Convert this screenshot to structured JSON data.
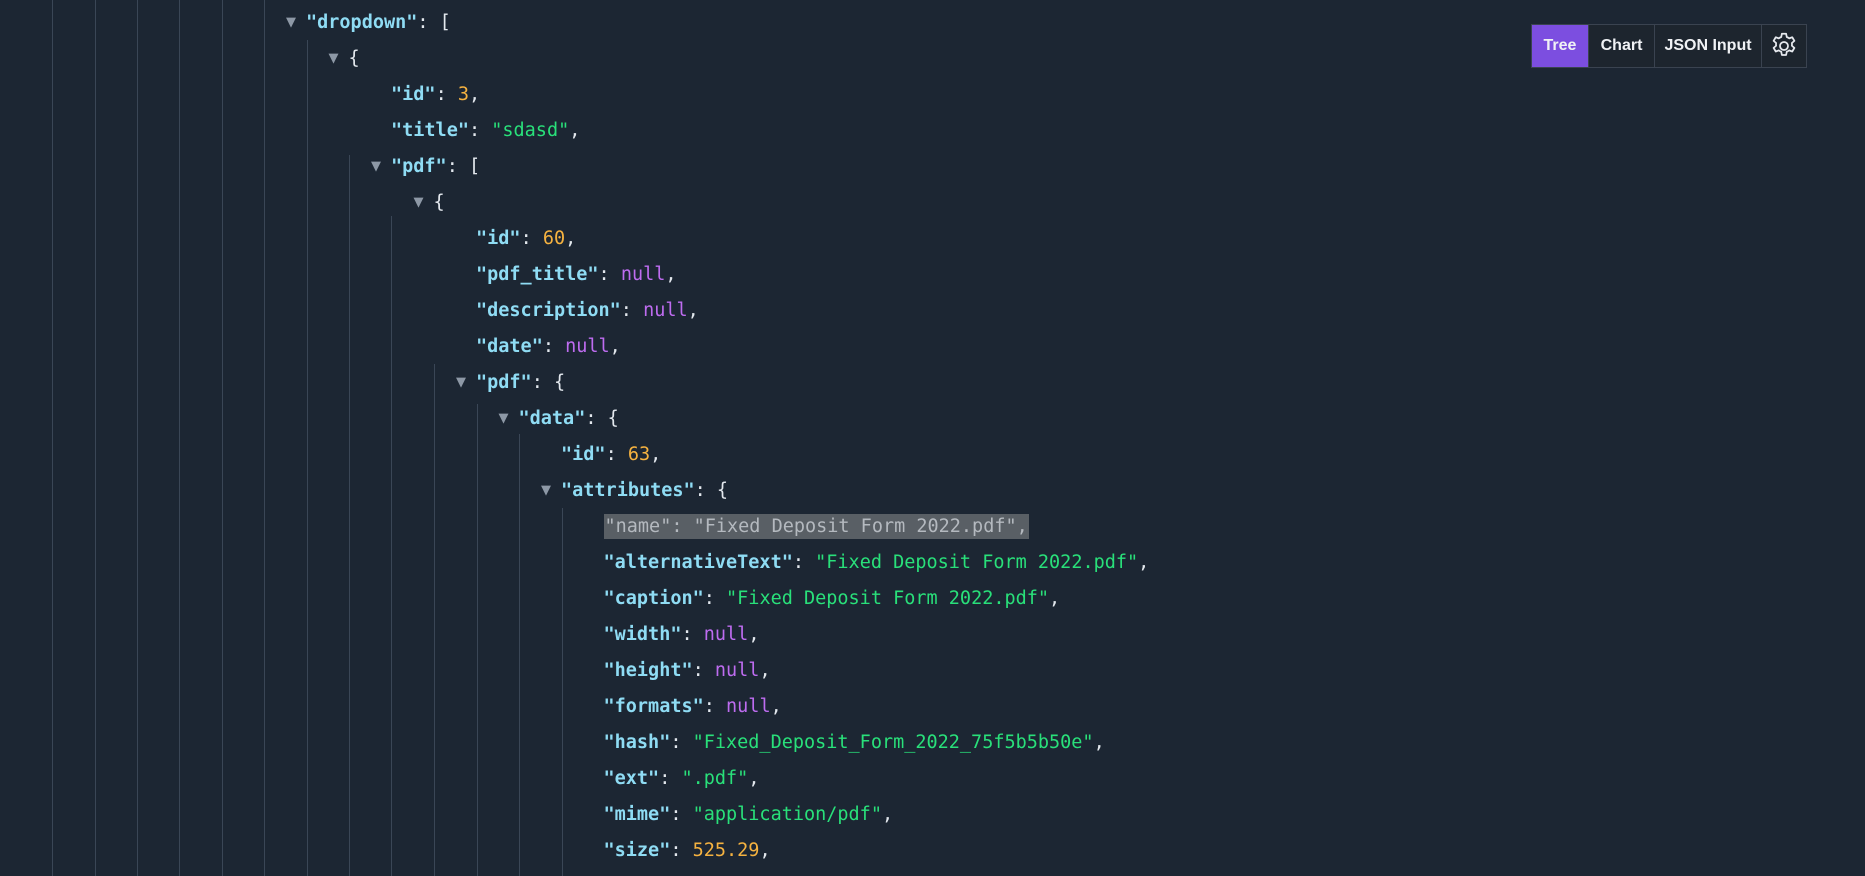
{
  "toolbar": {
    "tabs": [
      "Tree",
      "Chart",
      "JSON Input"
    ],
    "active_tab": "Tree",
    "active_color": "#7c4ee0",
    "settings_icon": "gear-icon"
  },
  "colors": {
    "background": "#1c2633",
    "key": "#8fdcf4",
    "string": "#29e07a",
    "number": "#f5b240",
    "null": "#be6cf0",
    "highlight": "#595f65"
  },
  "tree": [
    {
      "toggle": true,
      "tokens": [
        {
          "t": "key",
          "v": "\"dropdown\""
        },
        {
          "t": "pun",
          "v": ": ["
        }
      ]
    },
    {
      "toggle": true,
      "tokens": [
        {
          "t": "pun",
          "v": "{"
        }
      ]
    },
    {
      "toggle": false,
      "tokens": [
        {
          "t": "key",
          "v": "\"id\""
        },
        {
          "t": "pun",
          "v": ": "
        },
        {
          "t": "num",
          "v": "3"
        },
        {
          "t": "pun",
          "v": ","
        }
      ]
    },
    {
      "toggle": false,
      "tokens": [
        {
          "t": "key",
          "v": "\"title\""
        },
        {
          "t": "pun",
          "v": ": "
        },
        {
          "t": "str",
          "v": "\"sdasd\""
        },
        {
          "t": "pun",
          "v": ","
        }
      ]
    },
    {
      "toggle": true,
      "tokens": [
        {
          "t": "key",
          "v": "\"pdf\""
        },
        {
          "t": "pun",
          "v": ": ["
        }
      ]
    },
    {
      "toggle": true,
      "tokens": [
        {
          "t": "pun",
          "v": "{"
        }
      ]
    },
    {
      "toggle": false,
      "tokens": [
        {
          "t": "key",
          "v": "\"id\""
        },
        {
          "t": "pun",
          "v": ": "
        },
        {
          "t": "num",
          "v": "60"
        },
        {
          "t": "pun",
          "v": ","
        }
      ]
    },
    {
      "toggle": false,
      "tokens": [
        {
          "t": "key",
          "v": "\"pdf_title\""
        },
        {
          "t": "pun",
          "v": ": "
        },
        {
          "t": "nul",
          "v": "null"
        },
        {
          "t": "pun",
          "v": ","
        }
      ]
    },
    {
      "toggle": false,
      "tokens": [
        {
          "t": "key",
          "v": "\"description\""
        },
        {
          "t": "pun",
          "v": ": "
        },
        {
          "t": "nul",
          "v": "null"
        },
        {
          "t": "pun",
          "v": ","
        }
      ]
    },
    {
      "toggle": false,
      "tokens": [
        {
          "t": "key",
          "v": "\"date\""
        },
        {
          "t": "pun",
          "v": ": "
        },
        {
          "t": "nul",
          "v": "null"
        },
        {
          "t": "pun",
          "v": ","
        }
      ]
    },
    {
      "toggle": true,
      "tokens": [
        {
          "t": "key",
          "v": "\"pdf\""
        },
        {
          "t": "pun",
          "v": ": {"
        }
      ]
    },
    {
      "toggle": true,
      "tokens": [
        {
          "t": "key",
          "v": "\"data\""
        },
        {
          "t": "pun",
          "v": ": {"
        }
      ]
    },
    {
      "toggle": false,
      "tokens": [
        {
          "t": "key",
          "v": "\"id\""
        },
        {
          "t": "pun",
          "v": ": "
        },
        {
          "t": "num",
          "v": "63"
        },
        {
          "t": "pun",
          "v": ","
        }
      ]
    },
    {
      "toggle": true,
      "tokens": [
        {
          "t": "key",
          "v": "\"attributes\""
        },
        {
          "t": "pun",
          "v": ": {"
        }
      ]
    },
    {
      "toggle": false,
      "highlight": true,
      "tokens": [
        {
          "t": "key",
          "v": "\"name\""
        },
        {
          "t": "pun",
          "v": ": "
        },
        {
          "t": "str",
          "v": "\"Fixed Deposit Form 2022.pdf\""
        },
        {
          "t": "pun",
          "v": ","
        }
      ]
    },
    {
      "toggle": false,
      "tokens": [
        {
          "t": "key",
          "v": "\"alternativeText\""
        },
        {
          "t": "pun",
          "v": ": "
        },
        {
          "t": "str",
          "v": "\"Fixed Deposit Form 2022.pdf\""
        },
        {
          "t": "pun",
          "v": ","
        }
      ]
    },
    {
      "toggle": false,
      "tokens": [
        {
          "t": "key",
          "v": "\"caption\""
        },
        {
          "t": "pun",
          "v": ": "
        },
        {
          "t": "str",
          "v": "\"Fixed Deposit Form 2022.pdf\""
        },
        {
          "t": "pun",
          "v": ","
        }
      ]
    },
    {
      "toggle": false,
      "tokens": [
        {
          "t": "key",
          "v": "\"width\""
        },
        {
          "t": "pun",
          "v": ": "
        },
        {
          "t": "nul",
          "v": "null"
        },
        {
          "t": "pun",
          "v": ","
        }
      ]
    },
    {
      "toggle": false,
      "tokens": [
        {
          "t": "key",
          "v": "\"height\""
        },
        {
          "t": "pun",
          "v": ": "
        },
        {
          "t": "nul",
          "v": "null"
        },
        {
          "t": "pun",
          "v": ","
        }
      ]
    },
    {
      "toggle": false,
      "tokens": [
        {
          "t": "key",
          "v": "\"formats\""
        },
        {
          "t": "pun",
          "v": ": "
        },
        {
          "t": "nul",
          "v": "null"
        },
        {
          "t": "pun",
          "v": ","
        }
      ]
    },
    {
      "toggle": false,
      "tokens": [
        {
          "t": "key",
          "v": "\"hash\""
        },
        {
          "t": "pun",
          "v": ": "
        },
        {
          "t": "str",
          "v": "\"Fixed_Deposit_Form_2022_75f5b5b50e\""
        },
        {
          "t": "pun",
          "v": ","
        }
      ]
    },
    {
      "toggle": false,
      "tokens": [
        {
          "t": "key",
          "v": "\"ext\""
        },
        {
          "t": "pun",
          "v": ": "
        },
        {
          "t": "str",
          "v": "\".pdf\""
        },
        {
          "t": "pun",
          "v": ","
        }
      ]
    },
    {
      "toggle": false,
      "tokens": [
        {
          "t": "key",
          "v": "\"mime\""
        },
        {
          "t": "pun",
          "v": ": "
        },
        {
          "t": "str",
          "v": "\"application/pdf\""
        },
        {
          "t": "pun",
          "v": ","
        }
      ]
    },
    {
      "toggle": false,
      "tokens": [
        {
          "t": "key",
          "v": "\"size\""
        },
        {
          "t": "pun",
          "v": ": "
        },
        {
          "t": "num",
          "v": "525.29"
        },
        {
          "t": "pun",
          "v": ","
        }
      ]
    }
  ]
}
